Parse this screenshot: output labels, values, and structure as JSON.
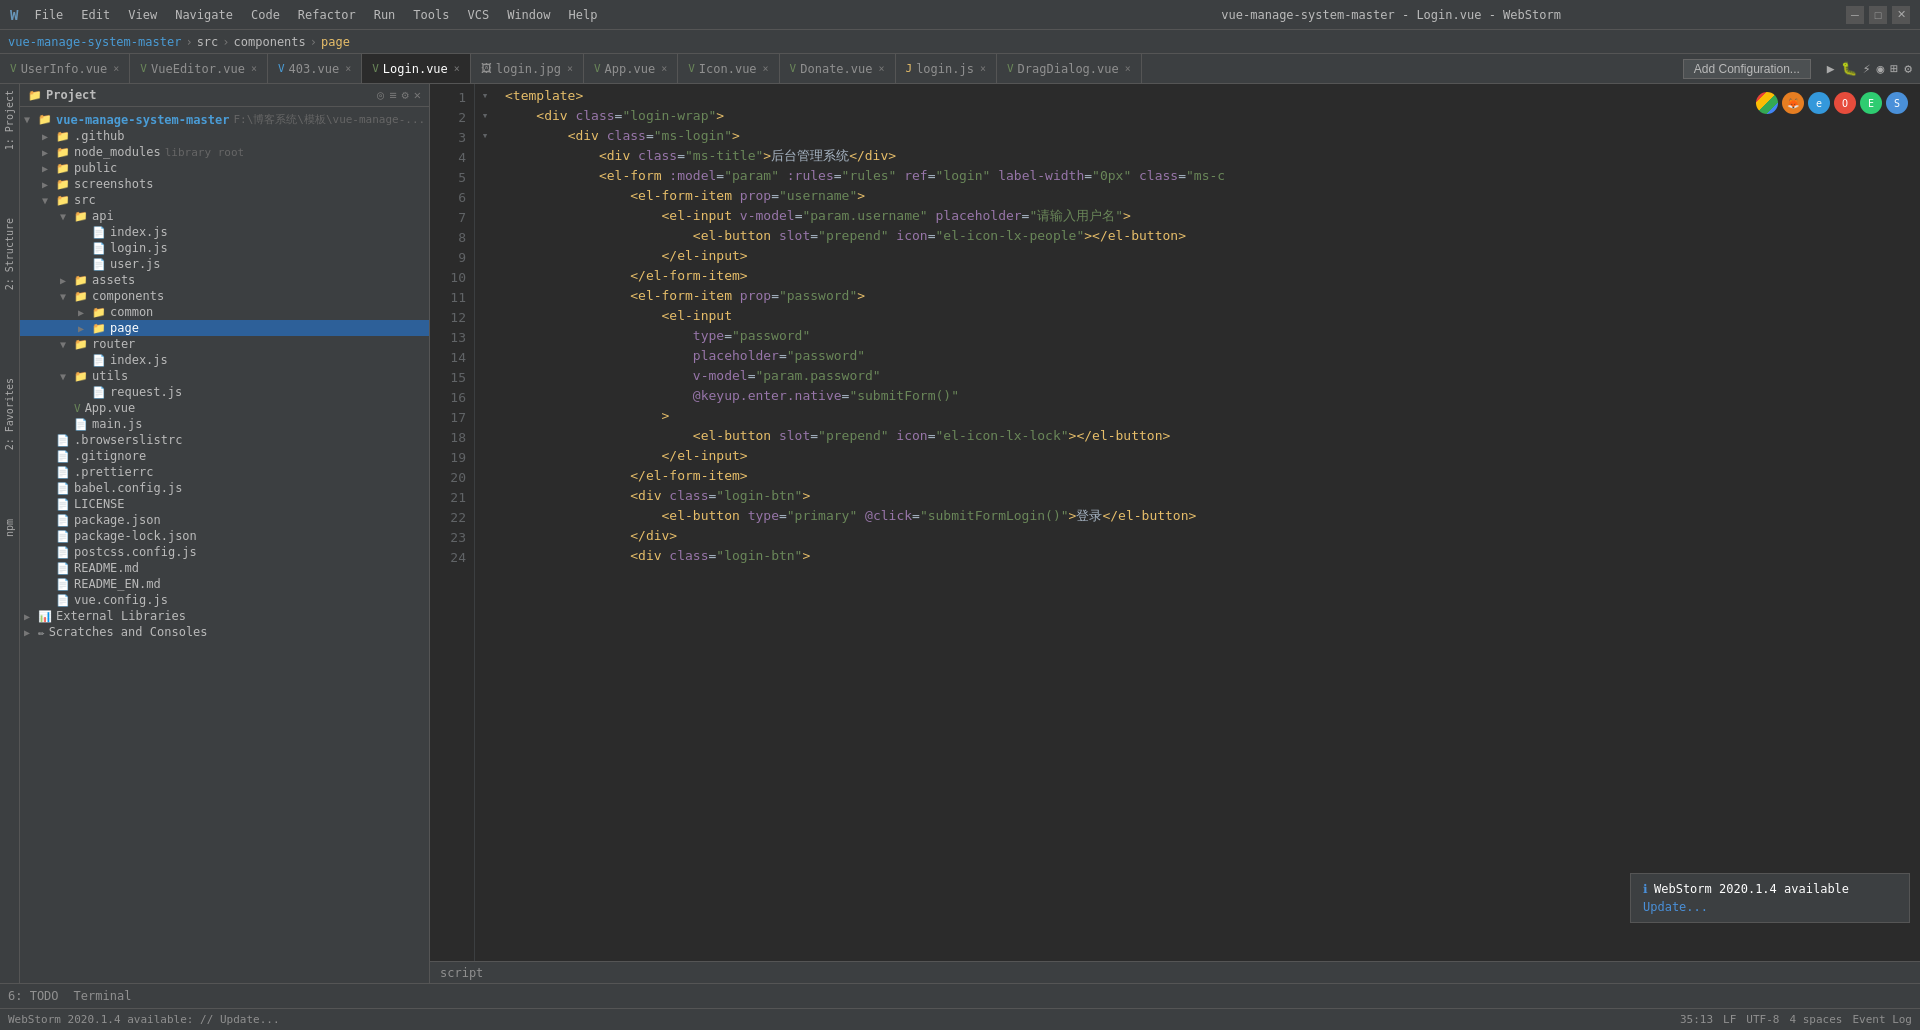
{
  "titleBar": {
    "appIcon": "W",
    "menuItems": [
      "File",
      "Edit",
      "View",
      "Navigate",
      "Code",
      "Refactor",
      "Run",
      "Tools",
      "VCS",
      "Window",
      "Help"
    ],
    "title": "vue-manage-system-master - Login.vue - WebStorm",
    "windowControls": [
      "─",
      "□",
      "✕"
    ]
  },
  "breadcrumb": {
    "items": [
      "vue-manage-system-master",
      "src",
      "components",
      "page"
    ]
  },
  "tabs": [
    {
      "label": "UserInfo.vue",
      "type": "vue",
      "active": false,
      "icon": "V"
    },
    {
      "label": "VueEditor.vue",
      "type": "vue",
      "active": false,
      "icon": "V"
    },
    {
      "label": "403.vue",
      "type": "vue",
      "active": false,
      "icon": "V"
    },
    {
      "label": "Login.vue",
      "type": "vue",
      "active": true,
      "icon": "V"
    },
    {
      "label": "login.jpg",
      "type": "img",
      "active": false
    },
    {
      "label": "App.vue",
      "type": "vue",
      "active": false,
      "icon": "V"
    },
    {
      "label": "Icon.vue",
      "type": "vue",
      "active": false,
      "icon": "V"
    },
    {
      "label": "Donate.vue",
      "type": "vue",
      "active": false,
      "icon": "V"
    },
    {
      "label": "login.js",
      "type": "js",
      "active": false
    },
    {
      "label": "DragDialog.vue",
      "type": "vue",
      "active": false,
      "icon": "V"
    }
  ],
  "addConfigBtn": "Add Configuration...",
  "projectTree": {
    "title": "Project",
    "items": [
      {
        "id": "root",
        "label": "vue-manage-system-master",
        "path": "F:\\博客系统\\模板\\vue-manage-...",
        "level": 0,
        "type": "root",
        "expanded": true
      },
      {
        "id": "github",
        "label": ".github",
        "level": 1,
        "type": "folder",
        "expanded": false
      },
      {
        "id": "node_modules",
        "label": "node_modules",
        "sublabel": "library root",
        "level": 1,
        "type": "folder",
        "expanded": false
      },
      {
        "id": "public",
        "label": "public",
        "level": 1,
        "type": "folder",
        "expanded": false
      },
      {
        "id": "screenshots",
        "label": "screenshots",
        "level": 1,
        "type": "folder",
        "expanded": false
      },
      {
        "id": "src",
        "label": "src",
        "level": 1,
        "type": "folder",
        "expanded": true
      },
      {
        "id": "api",
        "label": "api",
        "level": 2,
        "type": "folder",
        "expanded": true
      },
      {
        "id": "api_index",
        "label": "index.js",
        "level": 3,
        "type": "js"
      },
      {
        "id": "api_login",
        "label": "login.js",
        "level": 3,
        "type": "js"
      },
      {
        "id": "api_user",
        "label": "user.js",
        "level": 3,
        "type": "js"
      },
      {
        "id": "assets",
        "label": "assets",
        "level": 2,
        "type": "folder",
        "expanded": false
      },
      {
        "id": "components",
        "label": "components",
        "level": 2,
        "type": "folder",
        "expanded": true
      },
      {
        "id": "common",
        "label": "common",
        "level": 3,
        "type": "folder",
        "expanded": false
      },
      {
        "id": "page",
        "label": "page",
        "level": 3,
        "type": "folder",
        "expanded": false,
        "selected": true
      },
      {
        "id": "router",
        "label": "router",
        "level": 2,
        "type": "folder",
        "expanded": true
      },
      {
        "id": "router_index",
        "label": "index.js",
        "level": 3,
        "type": "js"
      },
      {
        "id": "utils",
        "label": "utils",
        "level": 2,
        "type": "folder",
        "expanded": true
      },
      {
        "id": "utils_request",
        "label": "request.js",
        "level": 3,
        "type": "js"
      },
      {
        "id": "app_vue",
        "label": "App.vue",
        "level": 2,
        "type": "vue"
      },
      {
        "id": "main_js",
        "label": "main.js",
        "level": 2,
        "type": "js"
      },
      {
        "id": "browserslistrc",
        "label": ".browserslistrc",
        "level": 1,
        "type": "config"
      },
      {
        "id": "gitignore",
        "label": ".gitignore",
        "level": 1,
        "type": "config"
      },
      {
        "id": "prettierrc",
        "label": ".prettierrc",
        "level": 1,
        "type": "config"
      },
      {
        "id": "babel_config",
        "label": "babel.config.js",
        "level": 1,
        "type": "js"
      },
      {
        "id": "license",
        "label": "LICENSE",
        "level": 1,
        "type": "txt"
      },
      {
        "id": "package_json",
        "label": "package.json",
        "level": 1,
        "type": "json"
      },
      {
        "id": "package_lock",
        "label": "package-lock.json",
        "level": 1,
        "type": "json"
      },
      {
        "id": "postcss_config",
        "label": "postcss.config.js",
        "level": 1,
        "type": "js"
      },
      {
        "id": "readme_md",
        "label": "README.md",
        "level": 1,
        "type": "md"
      },
      {
        "id": "readme_en",
        "label": "README_EN.md",
        "level": 1,
        "type": "md"
      },
      {
        "id": "vue_config",
        "label": "vue.config.js",
        "level": 1,
        "type": "js"
      },
      {
        "id": "ext_libs",
        "label": "External Libraries",
        "level": 0,
        "type": "libs"
      },
      {
        "id": "scratches",
        "label": "Scratches and Consoles",
        "level": 0,
        "type": "scratches"
      }
    ]
  },
  "codeLines": [
    {
      "num": 1,
      "content": "<template>",
      "tokens": [
        {
          "t": "tag",
          "v": "<template>"
        }
      ]
    },
    {
      "num": 2,
      "content": "    <div class=\"login-wrap\">",
      "tokens": [
        {
          "t": "text",
          "v": "    "
        },
        {
          "t": "tag",
          "v": "<div"
        },
        {
          "t": "attr",
          "v": " class"
        },
        {
          "t": "sym",
          "v": "="
        },
        {
          "t": "val",
          "v": "\"login-wrap\""
        },
        {
          "t": "tag",
          "v": ">"
        }
      ]
    },
    {
      "num": 3,
      "content": "        <div class=\"ms-login\">",
      "tokens": [
        {
          "t": "text",
          "v": "        "
        },
        {
          "t": "tag",
          "v": "<div"
        },
        {
          "t": "attr",
          "v": " class"
        },
        {
          "t": "sym",
          "v": "="
        },
        {
          "t": "val",
          "v": "\"ms-login\""
        },
        {
          "t": "tag",
          "v": ">"
        }
      ]
    },
    {
      "num": 4,
      "content": "            <div class=\"ms-title\">后台管理系统</div>",
      "tokens": [
        {
          "t": "text",
          "v": "            "
        },
        {
          "t": "tag",
          "v": "<div"
        },
        {
          "t": "attr",
          "v": " class"
        },
        {
          "t": "sym",
          "v": "="
        },
        {
          "t": "val",
          "v": "\"ms-title\""
        },
        {
          "t": "tag",
          "v": ">"
        },
        {
          "t": "text",
          "v": "后台管理系统"
        },
        {
          "t": "tag",
          "v": "</div>"
        }
      ]
    },
    {
      "num": 5,
      "content": "            <el-form :model=\"param\" :rules=\"rules\" ref=\"login\" label-width=\"0px\" class=\"ms-c",
      "tokens": [
        {
          "t": "text",
          "v": "            "
        },
        {
          "t": "tag",
          "v": "<el-form"
        },
        {
          "t": "attr",
          "v": " :model"
        },
        {
          "t": "sym",
          "v": "="
        },
        {
          "t": "val",
          "v": "\"param\""
        },
        {
          "t": "attr",
          "v": " :rules"
        },
        {
          "t": "sym",
          "v": "="
        },
        {
          "t": "val",
          "v": "\"rules\""
        },
        {
          "t": "attr",
          "v": " ref"
        },
        {
          "t": "sym",
          "v": "="
        },
        {
          "t": "val",
          "v": "\"login\""
        },
        {
          "t": "attr",
          "v": " label-width"
        },
        {
          "t": "sym",
          "v": "="
        },
        {
          "t": "val",
          "v": "\"0px\""
        },
        {
          "t": "attr",
          "v": " class"
        },
        {
          "t": "sym",
          "v": "="
        },
        {
          "t": "val",
          "v": "\"ms-c"
        }
      ]
    },
    {
      "num": 6,
      "content": "                <el-form-item prop=\"username\">",
      "tokens": [
        {
          "t": "text",
          "v": "                "
        },
        {
          "t": "tag",
          "v": "<el-form-item"
        },
        {
          "t": "attr",
          "v": " prop"
        },
        {
          "t": "sym",
          "v": "="
        },
        {
          "t": "val",
          "v": "\"username\""
        },
        {
          "t": "tag",
          "v": ">"
        }
      ]
    },
    {
      "num": 7,
      "content": "                    <el-input v-model=\"param.username\" placeholder=\"请输入用户名\">",
      "tokens": [
        {
          "t": "text",
          "v": "                    "
        },
        {
          "t": "tag",
          "v": "<el-input"
        },
        {
          "t": "attr",
          "v": " v-model"
        },
        {
          "t": "sym",
          "v": "="
        },
        {
          "t": "val",
          "v": "\"param.username\""
        },
        {
          "t": "attr",
          "v": " placeholder"
        },
        {
          "t": "sym",
          "v": "="
        },
        {
          "t": "val",
          "v": "\"请输入用户名\""
        },
        {
          "t": "tag",
          "v": ">"
        }
      ]
    },
    {
      "num": 8,
      "content": "                        <el-button slot=\"prepend\" icon=\"el-icon-lx-people\"></el-button>",
      "tokens": [
        {
          "t": "text",
          "v": "                        "
        },
        {
          "t": "tag",
          "v": "<el-button"
        },
        {
          "t": "attr",
          "v": " slot"
        },
        {
          "t": "sym",
          "v": "="
        },
        {
          "t": "val",
          "v": "\"prepend\""
        },
        {
          "t": "attr",
          "v": " icon"
        },
        {
          "t": "sym",
          "v": "="
        },
        {
          "t": "val",
          "v": "\"el-icon-lx-people\""
        },
        {
          "t": "tag",
          "v": "></el-button>"
        }
      ]
    },
    {
      "num": 9,
      "content": "                    </el-input>",
      "tokens": [
        {
          "t": "text",
          "v": "                    "
        },
        {
          "t": "tag",
          "v": "</el-input>"
        }
      ]
    },
    {
      "num": 10,
      "content": "                </el-form-item>",
      "tokens": [
        {
          "t": "text",
          "v": "                "
        },
        {
          "t": "tag",
          "v": "</el-form-item>"
        }
      ]
    },
    {
      "num": 11,
      "content": "                <el-form-item prop=\"password\">",
      "tokens": [
        {
          "t": "text",
          "v": "                "
        },
        {
          "t": "tag",
          "v": "<el-form-item"
        },
        {
          "t": "attr",
          "v": " prop"
        },
        {
          "t": "sym",
          "v": "="
        },
        {
          "t": "val",
          "v": "\"password\""
        },
        {
          "t": "tag",
          "v": ">"
        }
      ]
    },
    {
      "num": 12,
      "content": "                    <el-input",
      "tokens": [
        {
          "t": "text",
          "v": "                    "
        },
        {
          "t": "tag",
          "v": "<el-input"
        }
      ]
    },
    {
      "num": 13,
      "content": "                        type=\"password\"",
      "tokens": [
        {
          "t": "text",
          "v": "                        "
        },
        {
          "t": "attr",
          "v": "type"
        },
        {
          "t": "sym",
          "v": "="
        },
        {
          "t": "val",
          "v": "\"password\""
        }
      ]
    },
    {
      "num": 14,
      "content": "                        placeholder=\"password\"",
      "tokens": [
        {
          "t": "text",
          "v": "                        "
        },
        {
          "t": "attr",
          "v": "placeholder"
        },
        {
          "t": "sym",
          "v": "="
        },
        {
          "t": "val",
          "v": "\"password\""
        }
      ]
    },
    {
      "num": 15,
      "content": "                        v-model=\"param.password\"",
      "tokens": [
        {
          "t": "text",
          "v": "                        "
        },
        {
          "t": "attr",
          "v": "v-model"
        },
        {
          "t": "sym",
          "v": "="
        },
        {
          "t": "val",
          "v": "\"param.password\""
        }
      ]
    },
    {
      "num": 16,
      "content": "                        @keyup.enter.native=\"submitForm()\"",
      "tokens": [
        {
          "t": "text",
          "v": "                        "
        },
        {
          "t": "attr",
          "v": "@keyup.enter.native"
        },
        {
          "t": "sym",
          "v": "="
        },
        {
          "t": "val",
          "v": "\"submitForm()\""
        }
      ]
    },
    {
      "num": 17,
      "content": "                    >",
      "tokens": [
        {
          "t": "text",
          "v": "                    "
        },
        {
          "t": "tag",
          "v": ">"
        }
      ]
    },
    {
      "num": 18,
      "content": "                        <el-button slot=\"prepend\" icon=\"el-icon-lx-lock\"></el-button>",
      "tokens": [
        {
          "t": "text",
          "v": "                        "
        },
        {
          "t": "tag",
          "v": "<el-button"
        },
        {
          "t": "attr",
          "v": " slot"
        },
        {
          "t": "sym",
          "v": "="
        },
        {
          "t": "val",
          "v": "\"prepend\""
        },
        {
          "t": "attr",
          "v": " icon"
        },
        {
          "t": "sym",
          "v": "="
        },
        {
          "t": "val",
          "v": "\"el-icon-lx-lock\""
        },
        {
          "t": "tag",
          "v": "></el-button>"
        }
      ]
    },
    {
      "num": 19,
      "content": "                    </el-input>",
      "tokens": [
        {
          "t": "text",
          "v": "                    "
        },
        {
          "t": "tag",
          "v": "</el-input>"
        }
      ]
    },
    {
      "num": 20,
      "content": "                </el-form-item>",
      "tokens": [
        {
          "t": "text",
          "v": "                "
        },
        {
          "t": "tag",
          "v": "</el-form-item>"
        }
      ]
    },
    {
      "num": 21,
      "content": "                <div class=\"login-btn\">",
      "tokens": [
        {
          "t": "text",
          "v": "                "
        },
        {
          "t": "tag",
          "v": "<div"
        },
        {
          "t": "attr",
          "v": " class"
        },
        {
          "t": "sym",
          "v": "="
        },
        {
          "t": "val",
          "v": "\"login-btn\""
        },
        {
          "t": "tag",
          "v": ">"
        }
      ]
    },
    {
      "num": 22,
      "content": "                    <el-button type=\"primary\" @click=\"submitFormLogin()\">登录</el-button>",
      "tokens": [
        {
          "t": "text",
          "v": "                    "
        },
        {
          "t": "tag",
          "v": "<el-button"
        },
        {
          "t": "attr",
          "v": " type"
        },
        {
          "t": "sym",
          "v": "="
        },
        {
          "t": "val",
          "v": "\"primary\""
        },
        {
          "t": "attr",
          "v": " @click"
        },
        {
          "t": "sym",
          "v": "="
        },
        {
          "t": "val",
          "v": "\"submitFormLogin()\""
        },
        {
          "t": "tag",
          "v": ">"
        },
        {
          "t": "text",
          "v": "登录"
        },
        {
          "t": "tag",
          "v": "</el-button>"
        }
      ]
    },
    {
      "num": 23,
      "content": "                </div>",
      "tokens": [
        {
          "t": "text",
          "v": "                "
        },
        {
          "t": "tag",
          "v": "</div>"
        }
      ]
    },
    {
      "num": 24,
      "content": "                <div class=\"login-btn\">",
      "tokens": [
        {
          "t": "text",
          "v": "                "
        },
        {
          "t": "tag",
          "v": "<div"
        },
        {
          "t": "attr",
          "v": " class"
        },
        {
          "t": "sym",
          "v": "="
        },
        {
          "t": "val",
          "v": "\"login-btn\""
        },
        {
          "t": "tag",
          "v": ">"
        }
      ]
    }
  ],
  "bottomBar": {
    "todo": "6: TODO",
    "terminal": "Terminal"
  },
  "statusBar": {
    "message": "WebStorm 2020.1.4 available: // Update...",
    "position": "35:13",
    "lineEnding": "LF",
    "encoding": "UTF-8",
    "indent": "4 spaces",
    "eventLog": "Event Log"
  },
  "scriptLabel": "script",
  "notification": {
    "icon": "ℹ",
    "title": "WebStorm 2020.1.4 available",
    "link": "Update..."
  },
  "browserIcons": [
    {
      "name": "chrome",
      "color": "#e74c3c"
    },
    {
      "name": "firefox",
      "color": "#e67e22"
    },
    {
      "name": "edge-old",
      "color": "#3498db"
    },
    {
      "name": "opera",
      "color": "#e74c3c"
    },
    {
      "name": "edge",
      "color": "#2ecc71"
    },
    {
      "name": "safari",
      "color": "#4a90d9"
    }
  ]
}
